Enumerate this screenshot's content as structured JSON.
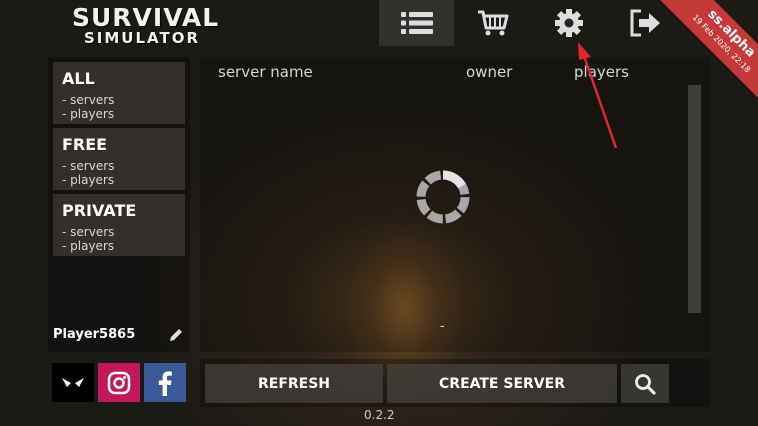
{
  "logo": {
    "line1": "SURVIVAL",
    "line2": "SIMULATOR"
  },
  "nav": [
    {
      "name": "servers-list",
      "icon": "list-icon",
      "active": true
    },
    {
      "name": "shop",
      "icon": "cart-icon"
    },
    {
      "name": "settings",
      "icon": "gear-icon"
    },
    {
      "name": "exit",
      "icon": "exit-icon"
    }
  ],
  "ribbon": {
    "title": "ss.alpha",
    "date": "19 Feb 2020, 22:18",
    "color": "#c4393a"
  },
  "sidebar": {
    "categories": [
      {
        "title": "ALL",
        "line1": "- servers",
        "line2": "- players"
      },
      {
        "title": "FREE",
        "line1": "- servers",
        "line2": "- players"
      },
      {
        "title": "PRIVATE",
        "line1": "- servers",
        "line2": "- players"
      }
    ],
    "player_name": "Player5865"
  },
  "table": {
    "columns": [
      "server name",
      "owner",
      "players"
    ],
    "status": "-"
  },
  "social": [
    {
      "name": "studio",
      "icon": "eyes-icon",
      "color": "#000000"
    },
    {
      "name": "instagram",
      "icon": "instagram-icon",
      "color": "#c2185b"
    },
    {
      "name": "facebook",
      "icon": "facebook-icon",
      "color": "#3b5998"
    }
  ],
  "actions": {
    "refresh": "REFRESH",
    "create": "CREATE SERVER"
  },
  "version": "0.2.2"
}
